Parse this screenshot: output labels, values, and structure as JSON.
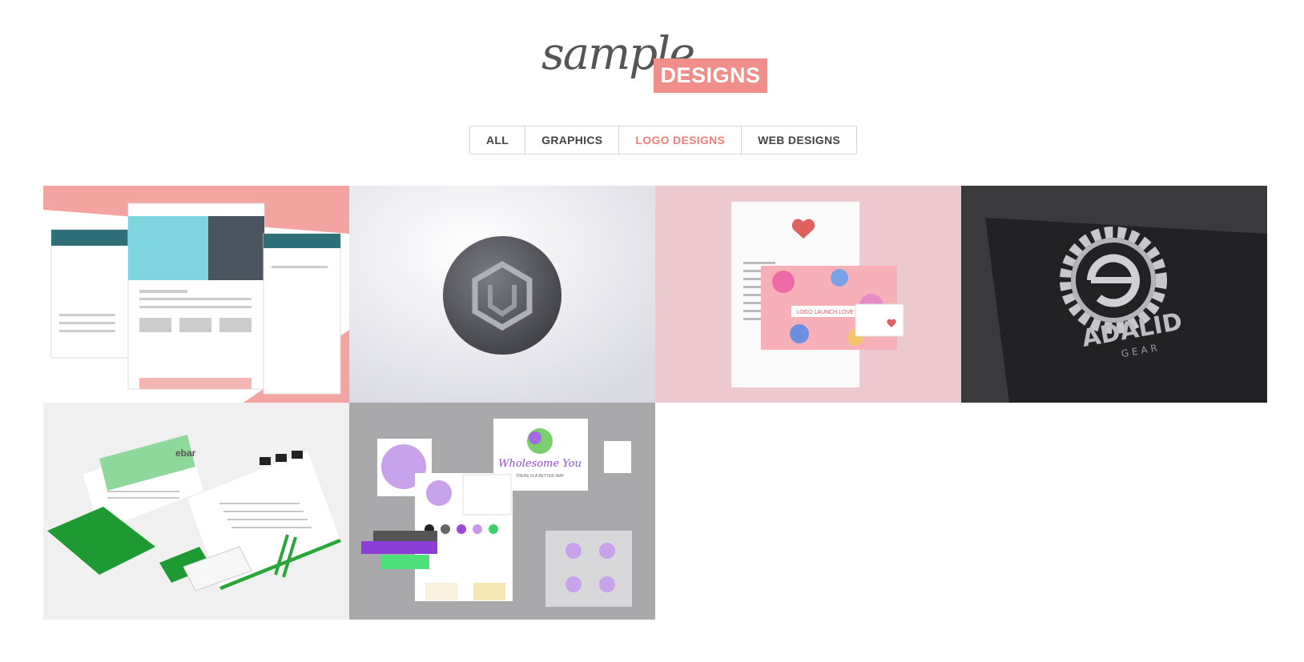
{
  "logo": {
    "script_text": "sample",
    "badge_text": "DESIGNS",
    "badge_color": "#f08e8a"
  },
  "filters": {
    "active": "LOGO DESIGNS",
    "tabs": [
      {
        "label": "ALL"
      },
      {
        "label": "GRAPHICS"
      },
      {
        "label": "LOGO DESIGNS"
      },
      {
        "label": "WEB DESIGNS"
      }
    ]
  },
  "gallery": {
    "items": [
      {
        "subject": "website mockup",
        "icon": "website-thumbnail"
      },
      {
        "subject": "embossed hexagon logo",
        "icon": "hexagon-emblem-thumbnail"
      },
      {
        "subject": "stationery",
        "icon": "stationery-thumbnail",
        "texts": {
          "brand": "LOGO LAUNCH LOVE"
        }
      },
      {
        "subject": "gear logo",
        "icon": "gear-logo-thumbnail",
        "texts": {
          "name": "ADALID",
          "sub": "GEAR"
        }
      },
      {
        "subject": "green stationery",
        "icon": "green-stationery-thumbnail",
        "texts": {
          "brand": "ebar"
        }
      },
      {
        "subject": "brand board",
        "icon": "brand-board-thumbnail",
        "texts": {
          "brand": "Wholesome You",
          "tagline": "THERE IS A BETTER WAY"
        }
      }
    ]
  }
}
